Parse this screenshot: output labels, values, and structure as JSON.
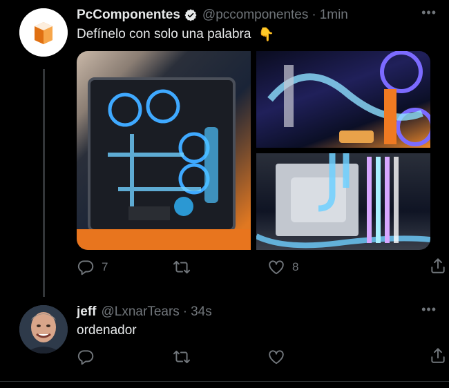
{
  "tweets": [
    {
      "author": {
        "name": "PcComponentes",
        "handle": "@pccomponentes",
        "verified": true,
        "avatar_icon": "pccomponentes-logo"
      },
      "separator": "·",
      "time": "1min",
      "text": "Defínelo con solo una palabra",
      "emoji": "👇",
      "more_label": "•••",
      "actions": {
        "reply_count": "7",
        "retweet_count": "",
        "like_count": "8"
      }
    },
    {
      "author": {
        "name": "jeff",
        "handle": "@LxnarTears",
        "avatar_icon": "user-avatar"
      },
      "separator": "·",
      "time": "34s",
      "text": "ordenador",
      "more_label": "•••",
      "actions": {
        "reply_count": "",
        "retweet_count": "",
        "like_count": ""
      }
    }
  ],
  "colors": {
    "background": "#000000",
    "text_primary": "#e7e9ea",
    "text_secondary": "#71767b",
    "verified": "#e7e9ea",
    "brand_orange": "#f28b1e"
  }
}
